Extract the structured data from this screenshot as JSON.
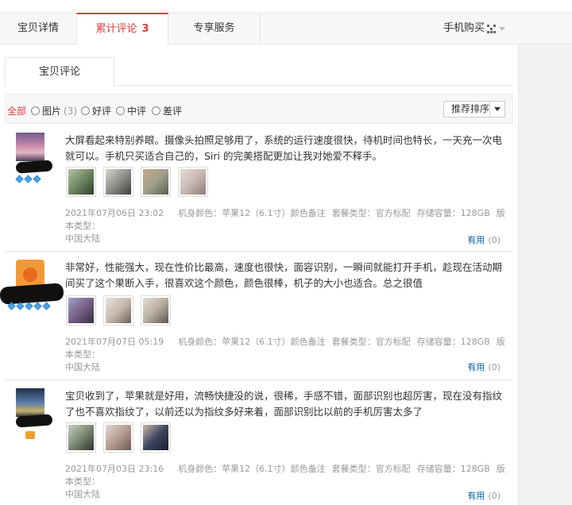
{
  "top_tabs": {
    "detail": "宝贝详情",
    "reviews": "累计评论",
    "reviews_count": "3",
    "service": "专享服务",
    "buy_on_phone": "手机购买"
  },
  "review_tab": "宝贝评论",
  "filters": {
    "all": "全部",
    "images": "图片",
    "images_count": "(3)",
    "good": "好评",
    "neutral": "中评",
    "bad": "差评"
  },
  "sort_label": "推荐排序",
  "colors": {
    "accent": "#e4393c",
    "link": "#005ea7",
    "muted": "#999999"
  },
  "reviews": [
    {
      "text": "大屏看起来特别养眼。摄像头拍照足够用了，系统的运行速度很快，待机时间也特长，一天充一次电就可以。手机只买适合自己的，Siri 的完美搭配更加让我对她爱不释手。",
      "date": "2021年07月06日 23:02",
      "color": "机身颜色：苹果12（6.1寸）颜色备注",
      "package": "套餐类型：官方标配",
      "storage": "存储容量：128GB",
      "version_label": "版本类型：",
      "version": "中国大陆",
      "helpful": "有用",
      "helpful_count": "(0)"
    },
    {
      "text": "非常好，性能强大，现在性价比最高，速度也很快，面容识别，一瞬间就能打开手机，趁现在活动期间买了这个果断入手，很喜欢这个颜色，颜色很棒，机子的大小也适合。总之很值",
      "date": "2021年07月07日 05:19",
      "color": "机身颜色：苹果12（6.1寸）颜色备注",
      "package": "套餐类型：官方标配",
      "storage": "存储容量：128GB",
      "version_label": "版本类型：",
      "version": "中国大陆",
      "helpful": "有用",
      "helpful_count": "(0)"
    },
    {
      "text": "宝贝收到了，苹果就是好用，流畅快捷没的说，很稀，手感不错，面部识别也超厉害，现在没有指纹了也不喜欢指纹了，以前还以为指纹多好来着，面部识别比以前的手机厉害太多了",
      "date": "2021年07月03日 23:16",
      "color": "机身颜色：苹果12（6.1寸）颜色备注",
      "package": "套餐类型：官方标配",
      "storage": "存储容量：128GB",
      "version_label": "版本类型：",
      "version": "中国大陆",
      "helpful": "有用",
      "helpful_count": "(0)"
    }
  ]
}
